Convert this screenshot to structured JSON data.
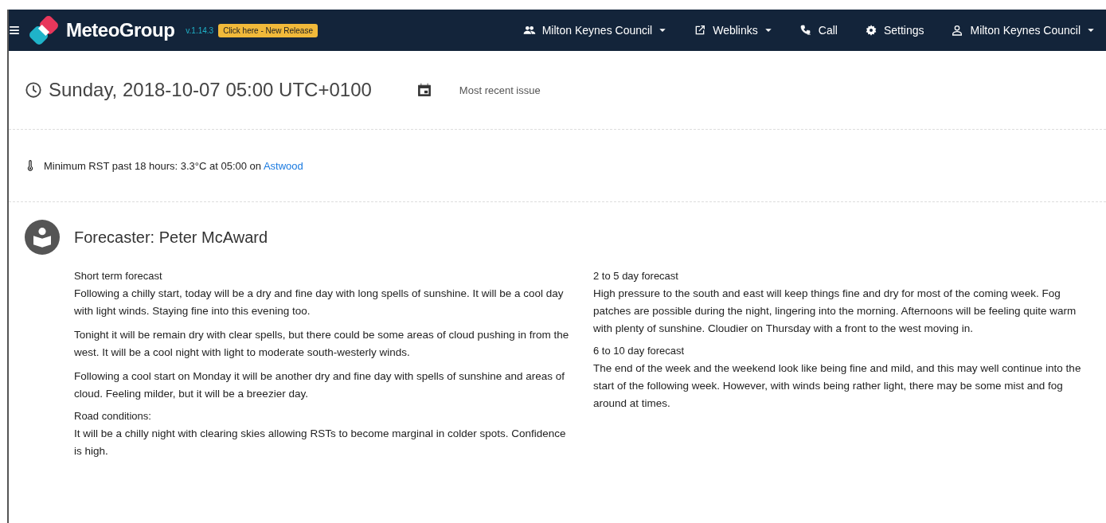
{
  "header": {
    "brand": "MeteoGroup",
    "version": "v.1.14.3",
    "release_badge": "Click here - New Release",
    "nav": [
      {
        "kind": "people",
        "label": "Milton Keynes Council",
        "dropdown": true
      },
      {
        "kind": "link",
        "label": "Weblinks",
        "dropdown": true
      },
      {
        "kind": "phone",
        "label": "Call",
        "dropdown": false
      },
      {
        "kind": "gear",
        "label": "Settings",
        "dropdown": false
      },
      {
        "kind": "user",
        "label": "Milton Keynes Council",
        "dropdown": true
      }
    ]
  },
  "issue": {
    "datetime": "Sunday, 2018-10-07 05:00 UTC+0100",
    "label": "Most recent issue"
  },
  "minimum_rst": {
    "text": "Minimum RST past 18 hours: 3.3°C at 05:00 on",
    "location": "Astwood"
  },
  "forecaster": "Forecaster: Peter McAward",
  "columns": [
    [
      {
        "title": "Short term forecast",
        "paragraphs": [
          "Following a chilly start, today will be a dry and fine day with long spells of sunshine. It will be a cool day with light winds. Staying fine into this evening too.",
          "Tonight it will be remain dry with clear spells, but there could be some areas of cloud pushing in from the west. It will be a cool night with light to moderate south-westerly winds.",
          "Following a cool start on Monday it will be another dry and fine day with spells of sunshine and areas of cloud. Feeling milder, but it will be a breezier day."
        ]
      },
      {
        "title": "Road conditions:",
        "paragraphs": [
          "It will be a chilly night with clearing skies allowing RSTs to become marginal in colder spots. Confidence is high."
        ]
      }
    ],
    [
      {
        "title": "2 to 5 day forecast",
        "paragraphs": [
          "High pressure to the south and east will keep things fine and dry for most of the coming week. Fog patches are possible during the night, lingering into the morning. Afternoons will be feeling quite warm with plenty of sunshine. Cloudier on Thursday with a front to the west moving in."
        ]
      },
      {
        "title": "6 to 10 day forecast",
        "paragraphs": [
          "The end of the week and the weekend look like being fine and mild, and this may well continue into the start of the following week. However, with winds being rather light, there may be some mist and fog around at times."
        ]
      }
    ]
  ]
}
